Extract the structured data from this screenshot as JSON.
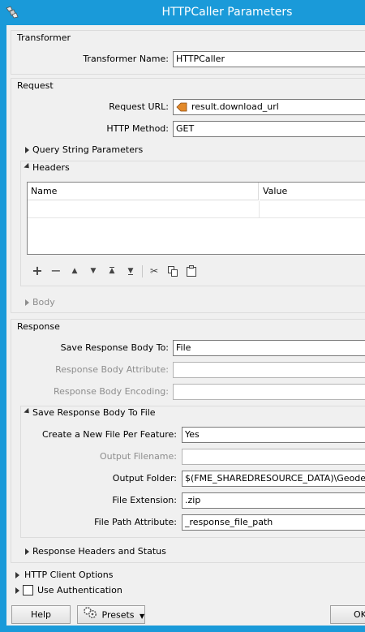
{
  "window": {
    "title": "HTTPCaller Parameters"
  },
  "transformer": {
    "header": "Transformer",
    "name_label": "Transformer Name:",
    "name_value": "HTTPCaller"
  },
  "request": {
    "header": "Request",
    "url_label": "Request URL:",
    "url_value": "result.download_url",
    "method_label": "HTTP Method:",
    "method_value": "GET",
    "query_section": "Query String Parameters",
    "headers_section": "Headers",
    "headers_columns": [
      "Name",
      "Value"
    ],
    "body_section": "Body"
  },
  "response": {
    "header": "Response",
    "save_to_label": "Save Response Body To:",
    "save_to_value": "File",
    "body_attr_label": "Response Body Attribute:",
    "body_attr_value": "",
    "body_enc_label": "Response Body Encoding:",
    "body_enc_value": "",
    "file_section": "Save Response Body To File",
    "new_file_label": "Create a New File Per Feature:",
    "new_file_value": "Yes",
    "out_filename_label": "Output Filename:",
    "out_filename_value": "",
    "out_folder_label": "Output Folder:",
    "out_folder_value": "$(FME_SHAREDRESOURCE_DATA)\\Geodesys\\",
    "ext_label": "File Extension:",
    "ext_value": ".zip",
    "path_attr_label": "File Path Attribute:",
    "path_attr_value": "_response_file_path",
    "headers_status_section": "Response Headers and Status"
  },
  "client_options": {
    "label": "HTTP Client Options"
  },
  "auth": {
    "label": "Use Authentication",
    "checked": false
  },
  "footer": {
    "help": "Help",
    "presets": "Presets",
    "ok": "OK"
  }
}
